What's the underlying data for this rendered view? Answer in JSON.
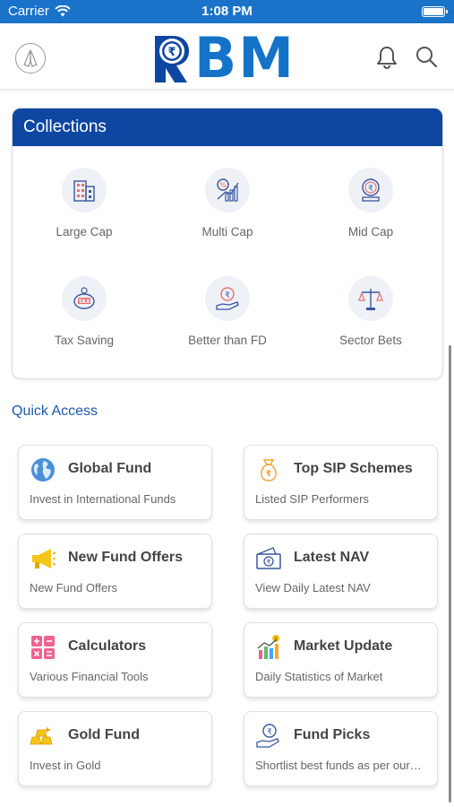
{
  "status_bar": {
    "carrier": "Carrier",
    "time": "1:08 PM"
  },
  "header": {
    "logo_text": "BM",
    "logo_r": "R"
  },
  "collections": {
    "title": "Collections",
    "items": [
      {
        "label": "Large Cap",
        "icon": "building-icon"
      },
      {
        "label": "Multi Cap",
        "icon": "percent-growth-icon"
      },
      {
        "label": "Mid Cap",
        "icon": "rupee-coin-stand-icon"
      },
      {
        "label": "Tax Saving",
        "icon": "piggy-bank-tax-icon"
      },
      {
        "label": "Better than FD",
        "icon": "rupee-hand-icon"
      },
      {
        "label": "Sector Bets",
        "icon": "scales-icon"
      }
    ]
  },
  "quick_access": {
    "title": "Quick Access",
    "cards": [
      {
        "title": "Global Fund",
        "subtitle": "Invest in International Funds",
        "icon": "globe-icon"
      },
      {
        "title": "Top SIP Schemes",
        "subtitle": "Listed SIP Performers",
        "icon": "money-bag-icon"
      },
      {
        "title": "New Fund Offers",
        "subtitle": "New Fund Offers",
        "icon": "megaphone-icon"
      },
      {
        "title": "Latest NAV",
        "subtitle": "View Daily Latest NAV",
        "icon": "banknote-icon"
      },
      {
        "title": "Calculators",
        "subtitle": "Various Financial Tools",
        "icon": "calculator-icon"
      },
      {
        "title": "Market Update",
        "subtitle": "Daily Statistics of Market",
        "icon": "bar-chart-icon"
      },
      {
        "title": "Gold Fund",
        "subtitle": "Invest in Gold",
        "icon": "gold-bars-icon"
      },
      {
        "title": "Fund Picks",
        "subtitle": "Shortlist best funds as per our…",
        "icon": "rupee-hand-icon"
      }
    ]
  },
  "colors": {
    "status_bar": "#1a73c9",
    "brand_blue": "#1573c7",
    "collections_header": "#0d47a1",
    "quick_access_title": "#1a5aa8"
  }
}
